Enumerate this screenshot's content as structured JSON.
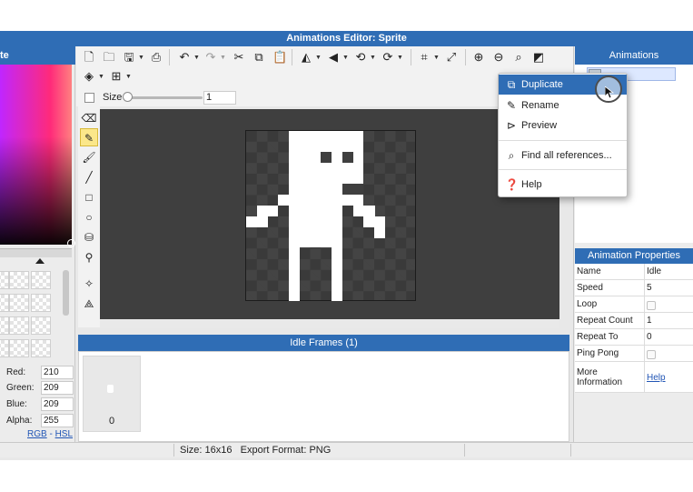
{
  "window": {
    "title": "Animations Editor: Sprite"
  },
  "color_panel": {
    "title": "te",
    "red_label": "Red:",
    "red_value": "210",
    "green_label": "Green:",
    "green_value": "209",
    "blue_label": "Blue:",
    "blue_value": "209",
    "alpha_label": "Alpha:",
    "alpha_value": "255",
    "rgb_link": "RGB",
    "hsl_link": "HSL",
    "link_sep": "-",
    "colors": {
      "gradient_left": "#c026ff",
      "gradient_right": "#ff8080"
    }
  },
  "toolbar": {
    "icons": [
      "new-file-icon",
      "open-folder-icon",
      "save-icon",
      "export-icon",
      "undo-icon",
      "redo-icon",
      "cut-icon",
      "copy-icon",
      "paste-icon",
      "flip-horizontal-icon",
      "flip-vertical-icon",
      "rotate-left-icon",
      "rotate-right-icon",
      "crop-icon",
      "resize-icon",
      "zoom-in-icon",
      "zoom-out-icon",
      "zoom-fit-icon",
      "toggle-bg-icon",
      "layers-icon",
      "grid-icon"
    ]
  },
  "size_bar": {
    "label": "Size",
    "value": "1",
    "slider_fraction": 0.0
  },
  "tools": [
    "select",
    "eraser",
    "pencil",
    "brush",
    "line",
    "rectangle",
    "ellipse",
    "fill",
    "eyedropper",
    "move-point",
    "transform"
  ],
  "active_tool": "pencil",
  "frames_panel": {
    "title": "Idle Frames (1)",
    "frames": [
      {
        "number": "0"
      }
    ]
  },
  "status_bar": {
    "text": "Size: 16x16   Export Format: PNG"
  },
  "animations_panel": {
    "title": "Animations"
  },
  "properties_panel": {
    "title": "Animation Properties",
    "rows": [
      {
        "name": "Name",
        "value": "Idle"
      },
      {
        "name": "Speed",
        "value": "5"
      },
      {
        "name": "Loop",
        "value": ""
      },
      {
        "name": "Repeat Count",
        "value": "1"
      },
      {
        "name": "Repeat To",
        "value": "0"
      },
      {
        "name": "Ping Pong",
        "value": ""
      },
      {
        "name": "More Information",
        "value": "Help"
      }
    ],
    "more_info_line1": "More",
    "more_info_line2": "Information"
  },
  "context_menu": {
    "items": [
      {
        "label": "Duplicate",
        "icon": "duplicate-icon",
        "highlighted": true
      },
      {
        "label": "Rename",
        "icon": "pencil-icon"
      },
      {
        "label": "Preview",
        "icon": "play-circle-icon"
      },
      {
        "label": "Find all references...",
        "icon": "search-icon"
      },
      {
        "label": "Help",
        "icon": "help-circle-icon"
      }
    ],
    "highlight_color": "#2f6db5"
  }
}
